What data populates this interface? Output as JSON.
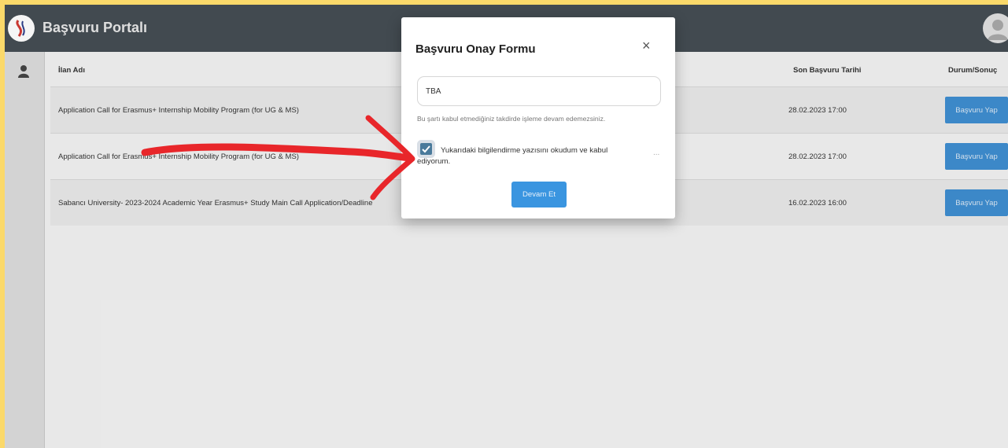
{
  "app": {
    "title": "Başvuru Portalı"
  },
  "table": {
    "headers": {
      "name": "İlan Adı",
      "deadline": "Son Başvuru Tarihi",
      "status": "Durum/Sonuç"
    },
    "rows": [
      {
        "name": "Application Call for Erasmus+ Internship Mobility Program (for UG & MS)",
        "deadline": "28.02.2023 17:00",
        "action": "Başvuru Yap"
      },
      {
        "name": "Application Call for Erasmus+ Internship Mobility Program (for UG & MS)",
        "deadline": "28.02.2023 17:00",
        "action": "Başvuru Yap"
      },
      {
        "name": "Sabancı University- 2023-2024 Academic Year Erasmus+ Study Main Call Application/Deadline",
        "deadline": "16.02.2023 16:00",
        "action": "Başvuru Yap"
      }
    ]
  },
  "modal": {
    "title": "Başvuru Onay Formu",
    "close": "×",
    "input_value": "TBA",
    "hint": "Bu şartı kabul etmediğiniz takdirde işleme devam edemezsiniz.",
    "checkbox_label": "Yukarıdaki bilgilendirme yazısını okudum ve kabul ediyorum.",
    "dots": "...",
    "continue_label": "Devam Et"
  },
  "colors": {
    "topbar": "#454e54",
    "button": "#3f8ed1",
    "arrow": "#e8262a",
    "border": "#fbd96a"
  }
}
